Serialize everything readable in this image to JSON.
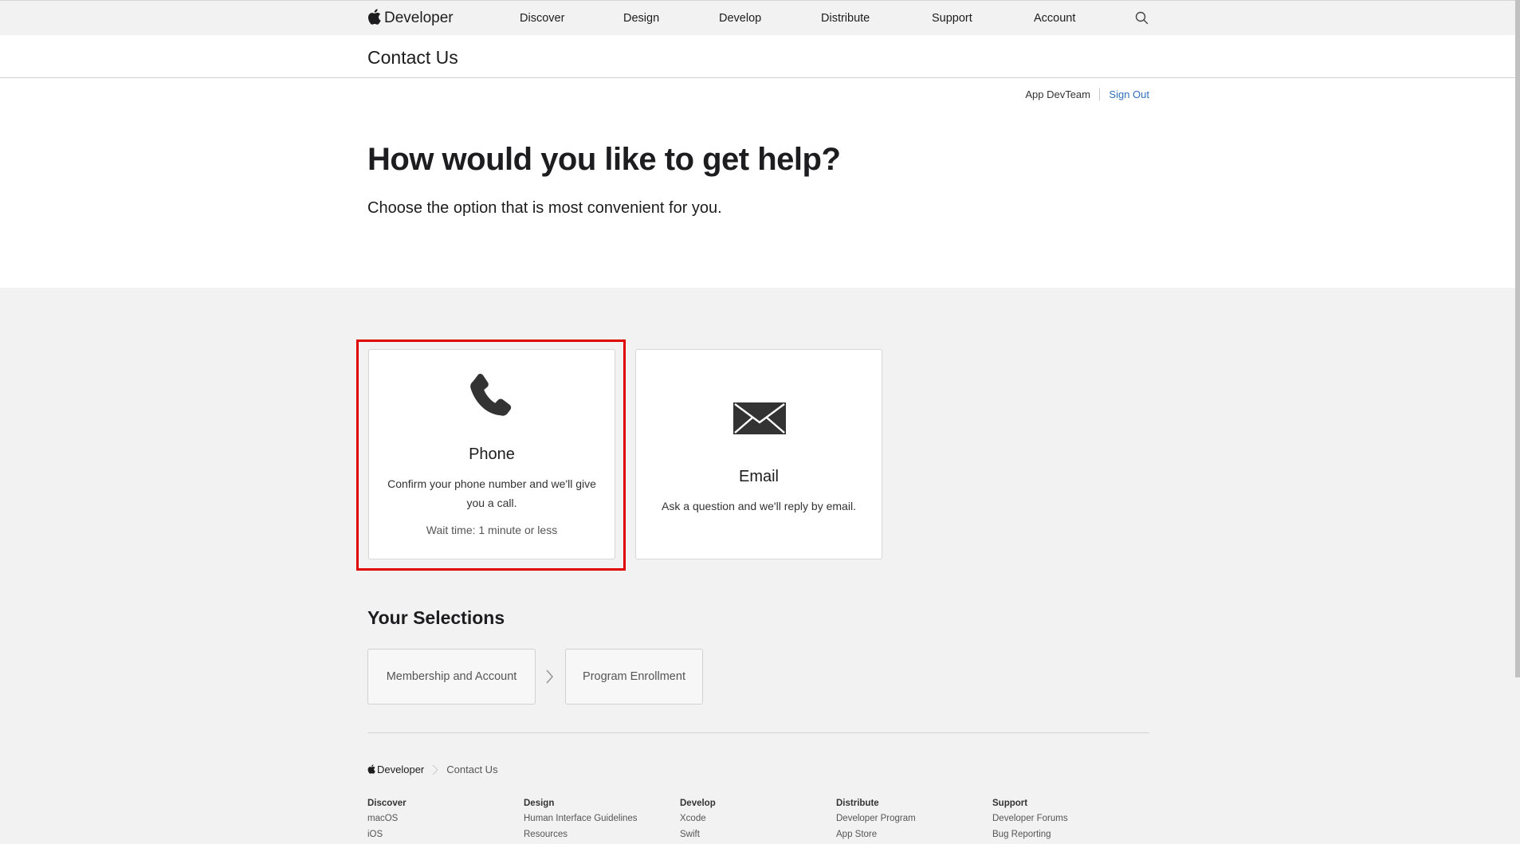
{
  "globalnav": {
    "brand": "Developer",
    "links": [
      "Discover",
      "Design",
      "Develop",
      "Distribute",
      "Support",
      "Account"
    ]
  },
  "localnav": {
    "title": "Contact Us"
  },
  "account": {
    "team": "App DevTeam",
    "sign_out": "Sign Out"
  },
  "hero": {
    "title": "How would you like to get help?",
    "subtitle": "Choose the option that is most convenient for you."
  },
  "options": {
    "phone": {
      "icon": "phone-icon",
      "title": "Phone",
      "description_line1": "Confirm your phone number and we'll give",
      "description_line2": "you a call.",
      "wait": "Wait time: 1 minute or less"
    },
    "email": {
      "icon": "envelope-icon",
      "title": "Email",
      "description": "Ask a question and we'll reply by email."
    }
  },
  "selections": {
    "heading": "Your Selections",
    "items": [
      "Membership and Account",
      "Program Enrollment"
    ]
  },
  "footer": {
    "brand": "Developer",
    "current": "Contact Us",
    "columns": [
      {
        "heading": "Discover",
        "links": [
          "macOS",
          "iOS"
        ]
      },
      {
        "heading": "Design",
        "links": [
          "Human Interface Guidelines",
          "Resources"
        ]
      },
      {
        "heading": "Develop",
        "links": [
          "Xcode",
          "Swift"
        ]
      },
      {
        "heading": "Distribute",
        "links": [
          "Developer Program",
          "App Store"
        ]
      },
      {
        "heading": "Support",
        "links": [
          "Developer Forums",
          "Bug Reporting"
        ]
      }
    ]
  },
  "colors": {
    "highlight": "#e10000",
    "link": "#2f6fba",
    "section_bg": "#f2f2f2"
  }
}
